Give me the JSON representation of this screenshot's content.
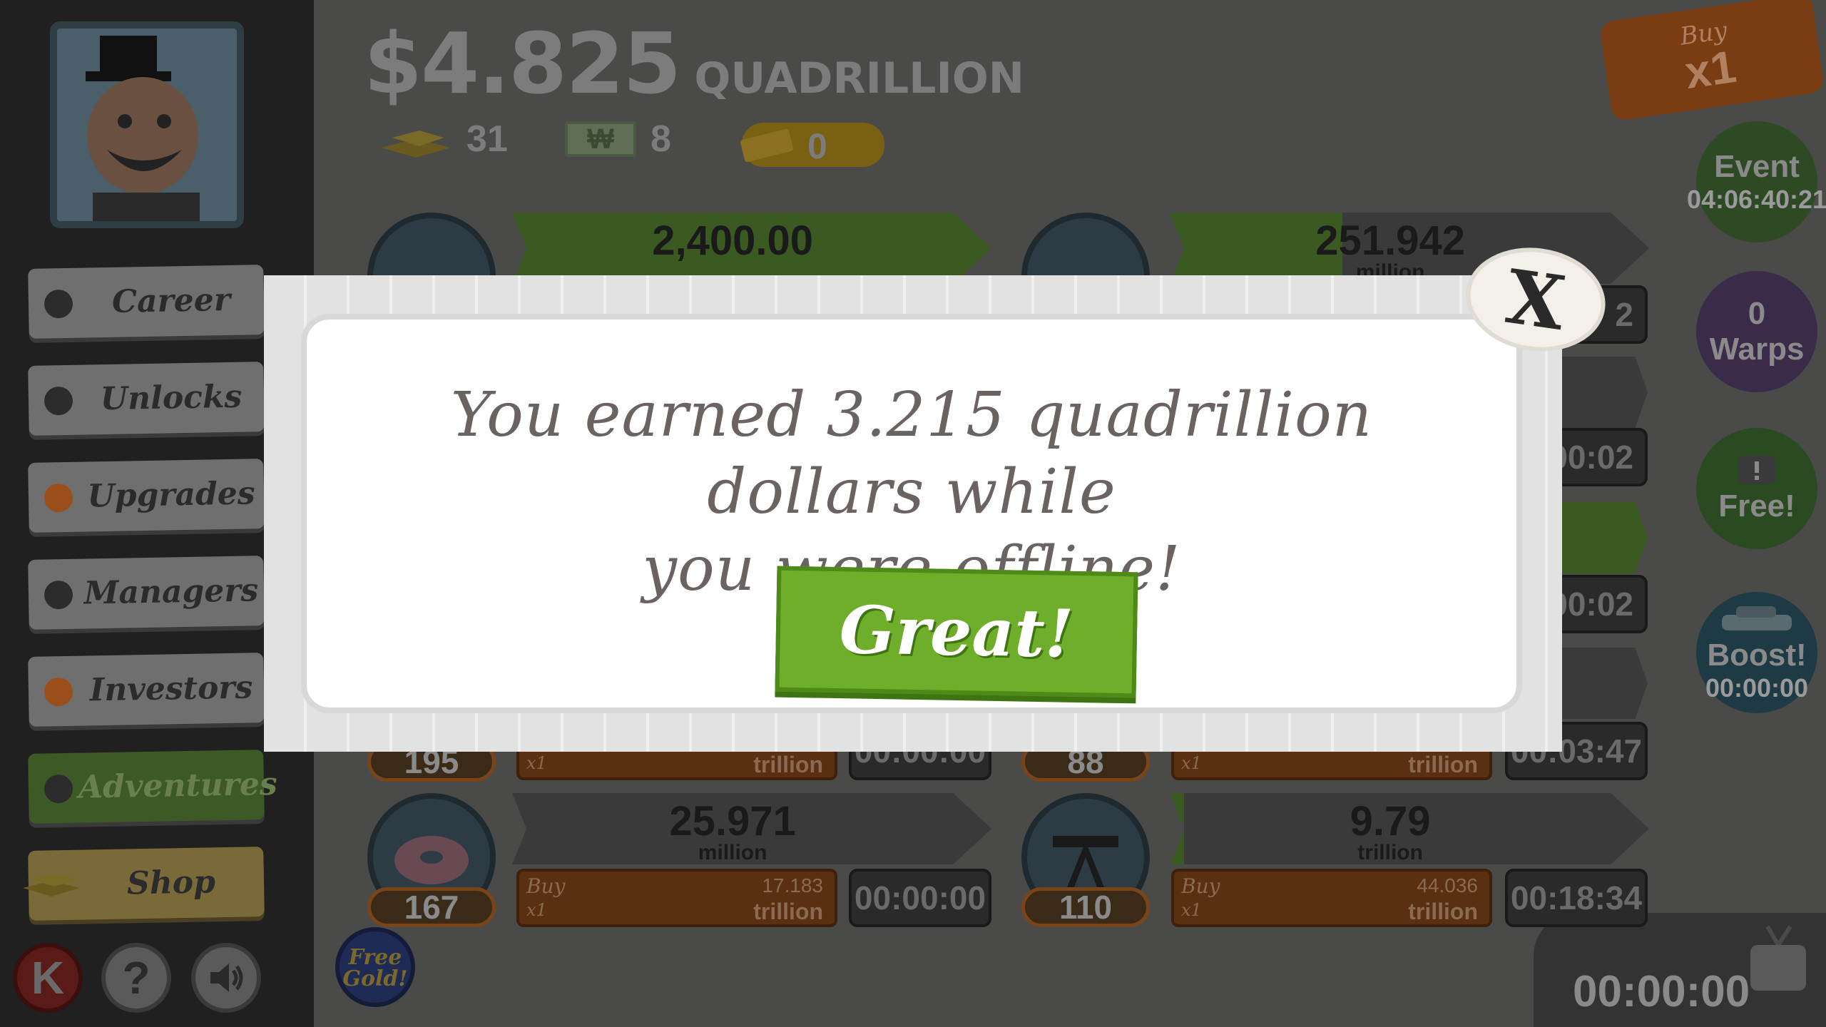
{
  "header": {
    "money_amount": "$4.825",
    "money_unit": "QUADRILLION",
    "gold_count": "31",
    "megabucks_count": "8",
    "tickets_count": "0",
    "bill_symbol": "₩"
  },
  "sidebar": {
    "items": [
      {
        "label": "Career",
        "dot": "dark"
      },
      {
        "label": "Unlocks",
        "dot": "dark"
      },
      {
        "label": "Upgrades",
        "dot": "orange"
      },
      {
        "label": "Managers",
        "dot": "dark"
      },
      {
        "label": "Investors",
        "dot": "orange"
      },
      {
        "label": "Adventures",
        "dot": "dark"
      },
      {
        "label": "Shop",
        "dot": "none"
      }
    ],
    "kong_label": "K",
    "help_label": "?",
    "sound_icon": "speaker-icon",
    "free_gold_label": "Free Gold!"
  },
  "rail": {
    "buy_small": "Buy",
    "buy_big": "x1",
    "event_label": "Event",
    "event_timer": "04:06:40:21",
    "warps_count": "0",
    "warps_label": "Warps",
    "free_label": "Free!",
    "boost_label": "Boost!",
    "boost_timer": "00:00:00",
    "tv_timer": "00:00:00"
  },
  "businesses": {
    "top_left_value": "2,400.00",
    "top_right_value": "251.942",
    "top_right_unit": "million",
    "partial_timer_1": "2",
    "partial_timer_2": "00:02",
    "partial_timer_3": "00:02",
    "partial_timer_4": "00:03:47",
    "mid_left_count": "195",
    "mid_left_unit": "trillion",
    "mid_left_buy": "x1",
    "mid_right_count": "88",
    "mid_right_unit": "trillion",
    "mid_right_buy": "x1",
    "mid_left_timer": "00:00:00",
    "donut": {
      "count": "167",
      "value": "25.971",
      "unit": "million",
      "buy_label": "Buy",
      "buy_qty": "x1",
      "cost": "17.183",
      "cost_unit": "trillion",
      "timer": "00:00:00"
    },
    "oil": {
      "count": "110",
      "value": "9.79",
      "unit": "trillion",
      "buy_label": "Buy",
      "buy_qty": "x1",
      "cost": "44.036",
      "cost_unit": "trillion",
      "timer": "00:18:34"
    }
  },
  "modal": {
    "message_line1": "You earned 3.215 quadrillion dollars while",
    "message_line2": "you were offline!",
    "confirm_label": "Great!",
    "close_label": "X"
  },
  "colors": {
    "confirm_green": "#6fae2b",
    "modal_text": "#6a6362"
  }
}
